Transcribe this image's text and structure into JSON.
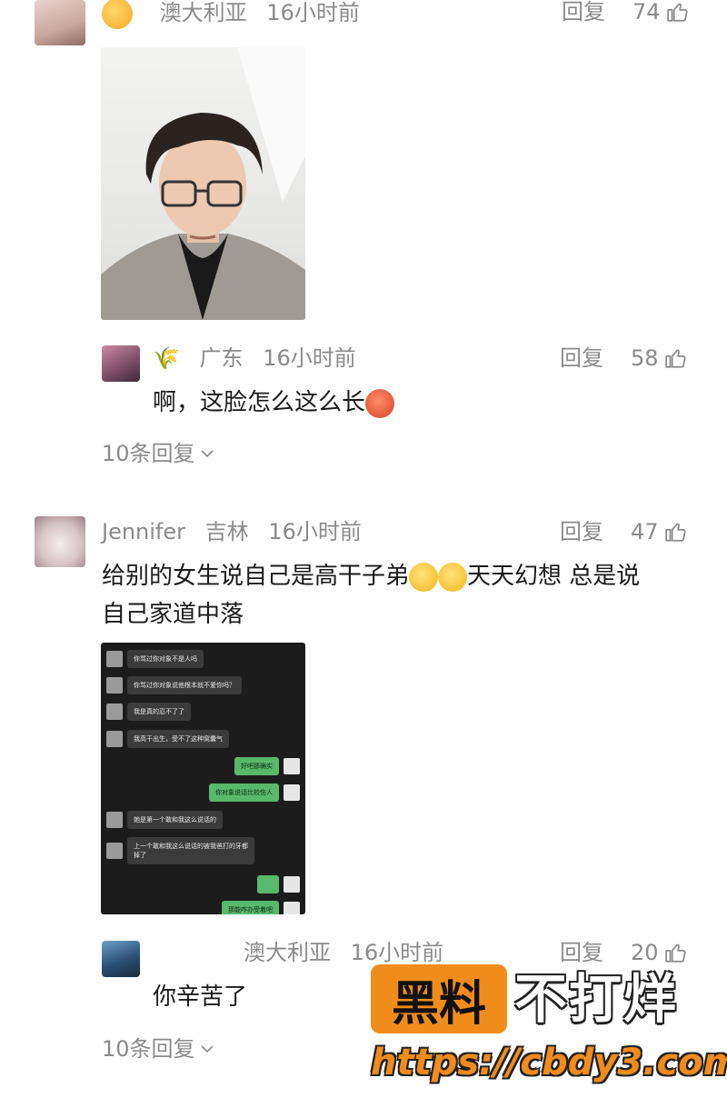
{
  "comments": [
    {
      "author": "",
      "location": "澳大利亚",
      "time": "16小时前",
      "reply_label": "回复",
      "likes": "74"
    },
    {
      "location": "广东",
      "time": "16小时前",
      "reply_label": "回复",
      "likes": "58",
      "text": "啊，这脸怎么这么长",
      "more_replies": "10条回复"
    },
    {
      "author": "Jennifer",
      "location": "吉林",
      "time": "16小时前",
      "reply_label": "回复",
      "likes": "47",
      "text_part1": "给别的女生说自己是高干子弟",
      "text_part2": "天天幻想 总是说",
      "text_line2": "自己家道中落"
    },
    {
      "location": "澳大利亚",
      "time": "16小时前",
      "reply_label": "回复",
      "likes": "20",
      "text": "你辛苦了",
      "more_replies": "10条回复"
    }
  ],
  "chat_screenshot": {
    "messages": [
      "你骂过你对象不是人吗",
      "你骂过你对象说他根本就不爱你吗？",
      "我是真的忍不了了",
      "我高干出生，受不了这种窝囊气",
      "好吧那确实",
      "你对象说话比较伤人",
      "她是第一个敢和我这么说话的",
      "上一个敢和我这么说话的被我爸打的牙都掉了",
      "那能咋办受着吧"
    ]
  },
  "watermark": {
    "brand": "黑料",
    "slogan": "不打烊",
    "url": "https://cbdy3.com"
  },
  "colors": {
    "meta_gray": "#8a8a8a",
    "text": "#1a1a1a",
    "wm_orange": "#f08c1c",
    "chat_green": "#58b86b"
  }
}
